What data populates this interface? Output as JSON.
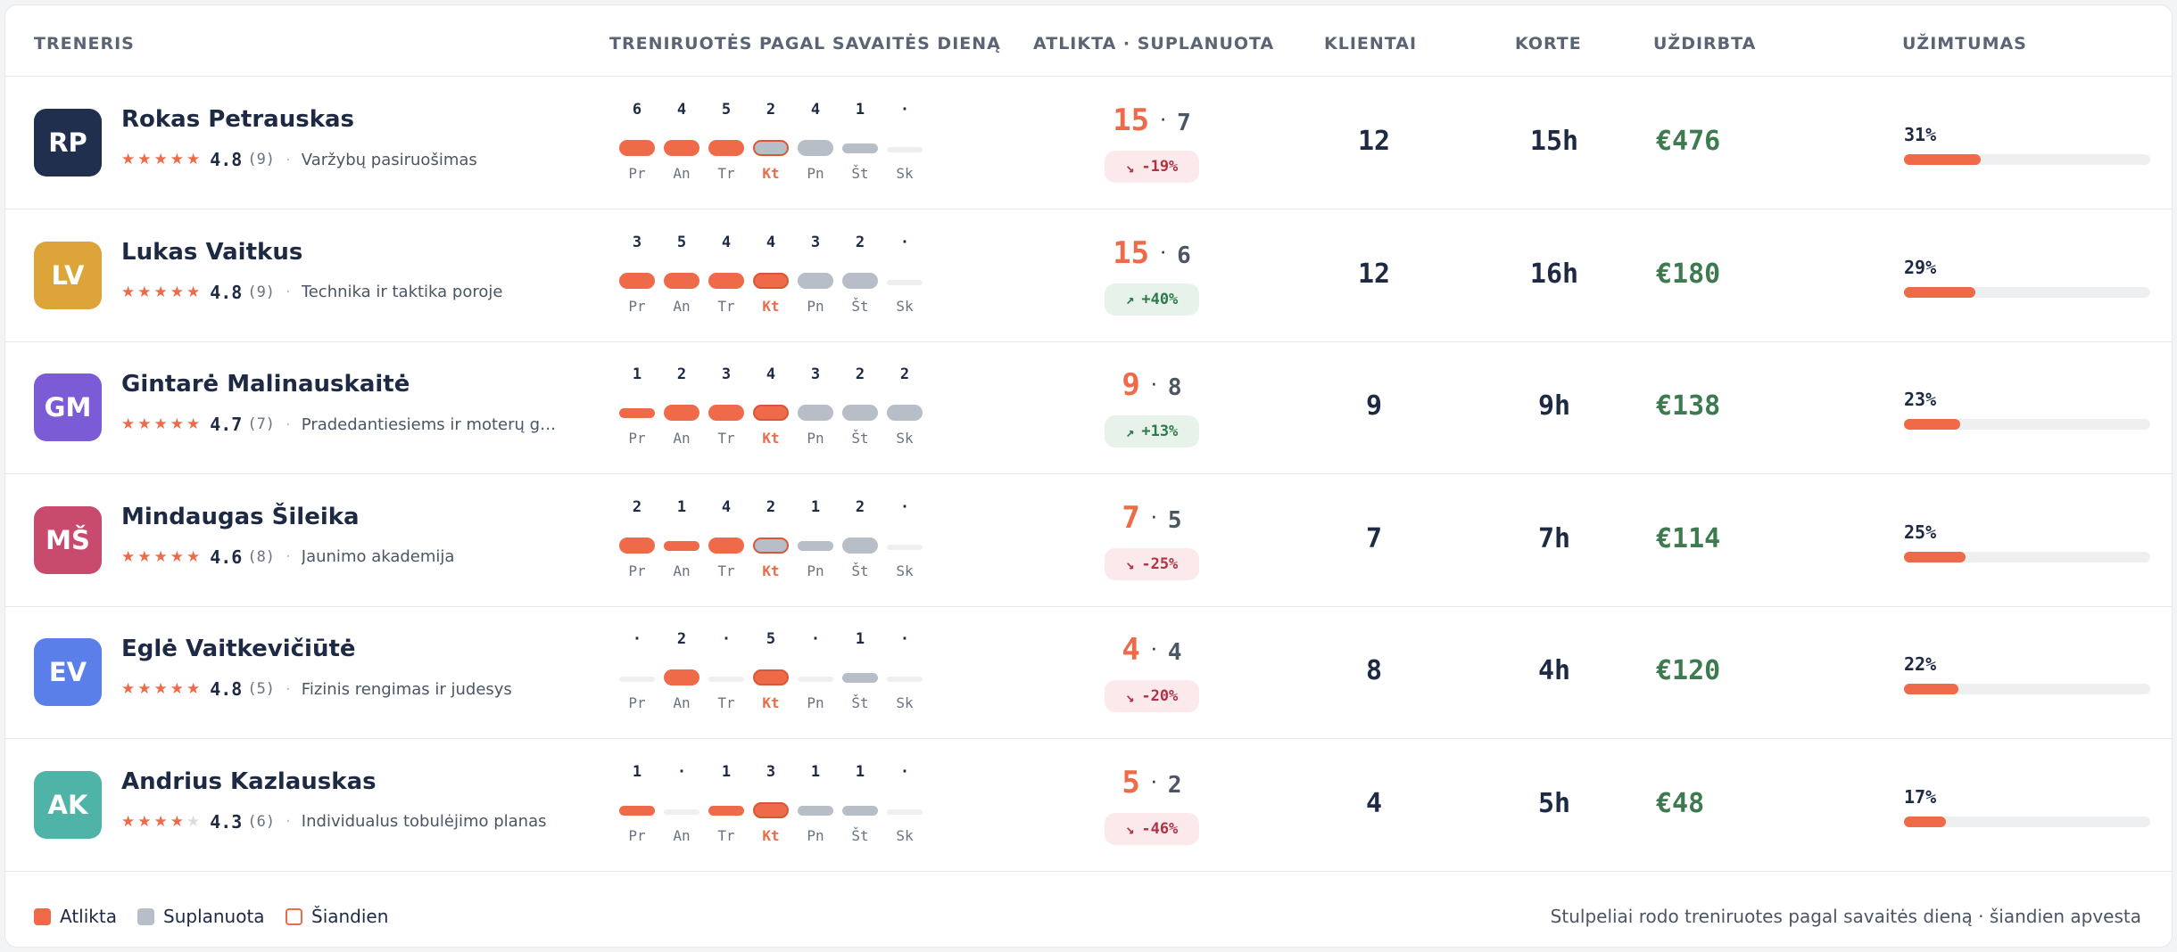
{
  "header": {
    "trainer": "TRENERIS",
    "by_day": "TRENIRUOTĖS PAGAL SAVAITĖS DIENĄ",
    "done_planned": "ATLIKTA · SUPLANUOTA",
    "clients": "KLIENTAI",
    "court": "KORTE",
    "earned": "UŽDIRBTA",
    "occupancy": "UŽIMTUMAS"
  },
  "colors": {
    "done": "#ee6a48",
    "planned": "#b8bec7",
    "empty": "#eeeff1",
    "earned": "#3d7a4f"
  },
  "day_labels": [
    "Pr",
    "An",
    "Tr",
    "Kt",
    "Pn",
    "Št",
    "Sk"
  ],
  "today_index": 3,
  "trainers": [
    {
      "initials": "RP",
      "avatar_color": "#1f2f4d",
      "name": "Rokas Petrauskas",
      "stars": 5,
      "rating": "4.8",
      "reviews": "(9)",
      "specialty": "Varžybų pasiruošimas",
      "day_counts": [
        "6",
        "4",
        "5",
        "2",
        "4",
        "1",
        "·"
      ],
      "day_status": [
        "done",
        "done",
        "done",
        "planned",
        "planned",
        "planned",
        "empty"
      ],
      "done": "15",
      "planned": "7",
      "delta": "-19%",
      "delta_dir": "down",
      "clients": "12",
      "court": "15h",
      "earned": "€476",
      "occupancy_label": "31%",
      "occupancy": 0.31
    },
    {
      "initials": "LV",
      "avatar_color": "#dda43a",
      "name": "Lukas Vaitkus",
      "stars": 5,
      "rating": "4.8",
      "reviews": "(9)",
      "specialty": "Technika ir taktika poroje",
      "day_counts": [
        "3",
        "5",
        "4",
        "4",
        "3",
        "2",
        "·"
      ],
      "day_status": [
        "done",
        "done",
        "done",
        "done",
        "planned",
        "planned",
        "empty"
      ],
      "done": "15",
      "planned": "6",
      "delta": "+40%",
      "delta_dir": "up",
      "clients": "12",
      "court": "16h",
      "earned": "€180",
      "occupancy_label": "29%",
      "occupancy": 0.29
    },
    {
      "initials": "GM",
      "avatar_color": "#7b5bd6",
      "name": "Gintarė Malinauskaitė",
      "stars": 5,
      "rating": "4.7",
      "reviews": "(7)",
      "specialty": "Pradedantiesiems ir moterų grupėms",
      "day_counts": [
        "1",
        "2",
        "3",
        "4",
        "3",
        "2",
        "2"
      ],
      "day_status": [
        "done",
        "done",
        "done",
        "done",
        "planned",
        "planned",
        "planned"
      ],
      "done": "9",
      "planned": "8",
      "delta": "+13%",
      "delta_dir": "up",
      "clients": "9",
      "court": "9h",
      "earned": "€138",
      "occupancy_label": "23%",
      "occupancy": 0.23
    },
    {
      "initials": "MŠ",
      "avatar_color": "#c84a6c",
      "name": "Mindaugas Šileika",
      "stars": 5,
      "rating": "4.6",
      "reviews": "(8)",
      "specialty": "Jaunimo akademija",
      "day_counts": [
        "2",
        "1",
        "4",
        "2",
        "1",
        "2",
        "·"
      ],
      "day_status": [
        "done",
        "done",
        "done",
        "planned",
        "planned",
        "planned",
        "empty"
      ],
      "done": "7",
      "planned": "5",
      "delta": "-25%",
      "delta_dir": "down",
      "clients": "7",
      "court": "7h",
      "earned": "€114",
      "occupancy_label": "25%",
      "occupancy": 0.25
    },
    {
      "initials": "EV",
      "avatar_color": "#5b7fe8",
      "name": "Eglė Vaitkevičiūtė",
      "stars": 5,
      "rating": "4.8",
      "reviews": "(5)",
      "specialty": "Fizinis rengimas ir judesys",
      "day_counts": [
        "·",
        "2",
        "·",
        "5",
        "·",
        "1",
        "·"
      ],
      "day_status": [
        "empty",
        "done",
        "empty",
        "done",
        "empty",
        "planned",
        "empty"
      ],
      "done": "4",
      "planned": "4",
      "delta": "-20%",
      "delta_dir": "down",
      "clients": "8",
      "court": "4h",
      "earned": "€120",
      "occupancy_label": "22%",
      "occupancy": 0.22
    },
    {
      "initials": "AK",
      "avatar_color": "#4fb3a7",
      "name": "Andrius Kazlauskas",
      "stars": 4,
      "rating": "4.3",
      "reviews": "(6)",
      "specialty": "Individualus tobulėjimo planas",
      "day_counts": [
        "1",
        "·",
        "1",
        "3",
        "1",
        "1",
        "·"
      ],
      "day_status": [
        "done",
        "empty",
        "done",
        "done",
        "planned",
        "planned",
        "empty"
      ],
      "done": "5",
      "planned": "2",
      "delta": "-46%",
      "delta_dir": "down",
      "clients": "4",
      "court": "5h",
      "earned": "€48",
      "occupancy_label": "17%",
      "occupancy": 0.17
    }
  ],
  "legend": {
    "done": "Atlikta",
    "planned": "Suplanuota",
    "today": "Šiandien"
  },
  "footnote": "Stulpeliai rodo treniruotes pagal savaitės dieną · šiandien apvesta"
}
